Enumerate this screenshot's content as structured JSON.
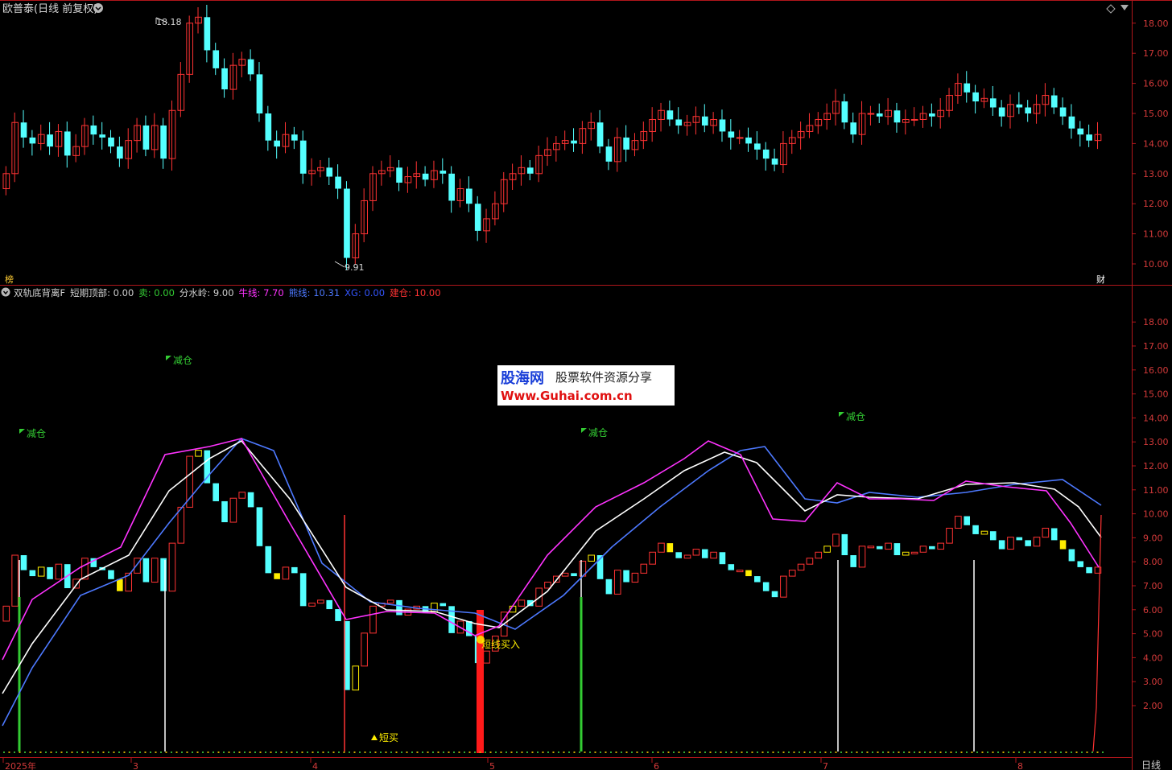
{
  "window": {
    "title": "欧普泰(日线 前复权)",
    "period_label": "日线"
  },
  "main_panel": {
    "price_axis": [
      "18.00",
      "17.00",
      "16.00",
      "15.00",
      "14.00",
      "13.00",
      "12.00",
      "11.00",
      "10.00"
    ],
    "high_label": "18.18",
    "low_label": "9.91",
    "left_tag": "榜",
    "right_tag": "财"
  },
  "indicator_panel": {
    "legend": [
      {
        "text": "双轨底背离F",
        "color": "#d0d0d0"
      },
      {
        "text": "短期顶部: 0.00",
        "color": "#d0d0d0"
      },
      {
        "text": "卖: 0.00",
        "color": "#33cc33"
      },
      {
        "text": "分水岭: 9.00",
        "color": "#d0d0d0"
      },
      {
        "text": "牛线: 7.70",
        "color": "#ff33ff"
      },
      {
        "text": "熊线: 10.31",
        "color": "#4d79ff"
      },
      {
        "text": "XG: 0.00",
        "color": "#3355ff"
      },
      {
        "text": "建仓: 10.00",
        "color": "#ff3333"
      }
    ],
    "axis": [
      "18.00",
      "17.00",
      "16.00",
      "15.00",
      "14.00",
      "13.00",
      "12.00",
      "11.00",
      "10.00",
      "9.00",
      "8.00",
      "7.00",
      "6.00",
      "5.00",
      "4.00",
      "3.00",
      "2.00"
    ],
    "signals": {
      "reduce": "减仓",
      "short_buy": "短买",
      "short_line_buy": "短线买入"
    },
    "watermark": {
      "brand": "股海网",
      "tagline": "股票软件资源分享",
      "url": "Www.Guhai.com.cn"
    }
  },
  "time_axis": [
    "2025年",
    "3",
    "4",
    "5",
    "6",
    "7",
    "8"
  ],
  "colors": {
    "up": "#ff3333",
    "down": "#54ffff",
    "frame": "#b0161b",
    "bull": "#ff33ff",
    "bear": "#4d79ff",
    "mid": "#ffffff",
    "yellow": "#ffee00"
  }
}
